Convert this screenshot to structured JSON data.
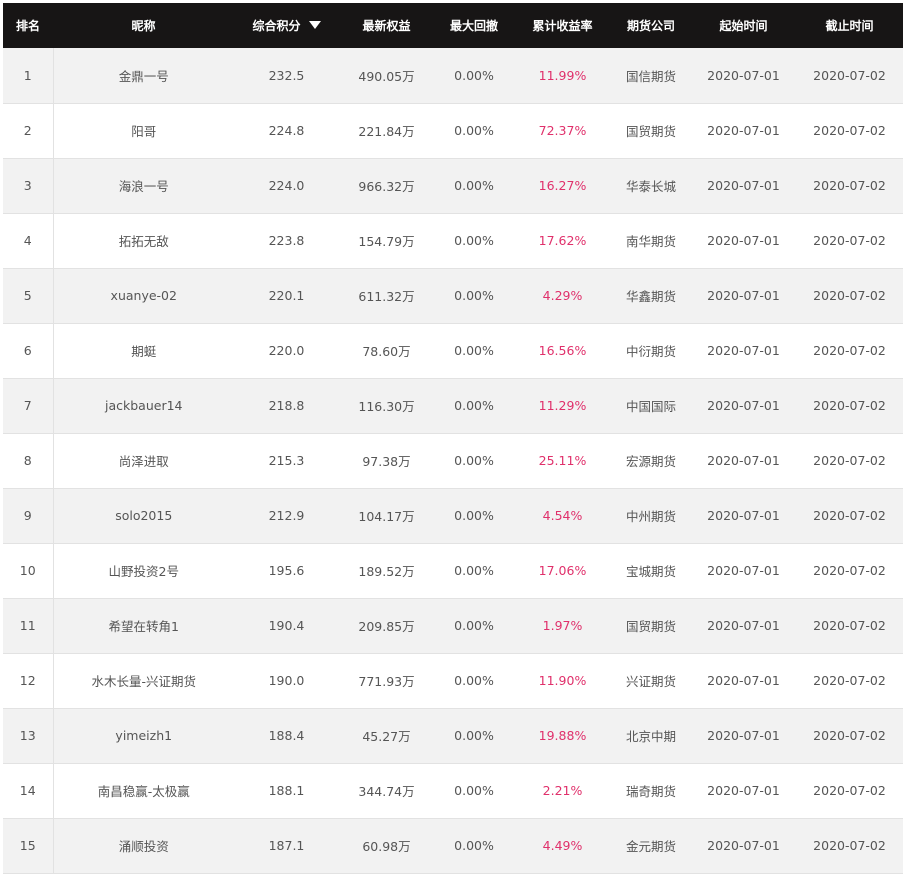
{
  "header": {
    "rank": "排名",
    "nickname": "昵称",
    "score": "综合积分",
    "equity": "最新权益",
    "drawdown": "最大回撤",
    "return": "累计收益率",
    "company": "期货公司",
    "start": "起始时间",
    "end": "截止时间",
    "sort_icon": "caret-down-icon"
  },
  "colors": {
    "header_bg": "#171515",
    "return_text": "#e0306b",
    "odd_row": "#f2f2f2"
  },
  "rows": [
    {
      "rank": "1",
      "nickname": "金鼎一号",
      "score": "232.5",
      "equity": "490.05万",
      "drawdown": "0.00%",
      "return": "11.99%",
      "company": "国信期货",
      "start": "2020-07-01",
      "end": "2020-07-02"
    },
    {
      "rank": "2",
      "nickname": "阳哥",
      "score": "224.8",
      "equity": "221.84万",
      "drawdown": "0.00%",
      "return": "72.37%",
      "company": "国贸期货",
      "start": "2020-07-01",
      "end": "2020-07-02"
    },
    {
      "rank": "3",
      "nickname": "海浪一号",
      "score": "224.0",
      "equity": "966.32万",
      "drawdown": "0.00%",
      "return": "16.27%",
      "company": "华泰长城",
      "start": "2020-07-01",
      "end": "2020-07-02"
    },
    {
      "rank": "4",
      "nickname": "拓拓无敌",
      "score": "223.8",
      "equity": "154.79万",
      "drawdown": "0.00%",
      "return": "17.62%",
      "company": "南华期货",
      "start": "2020-07-01",
      "end": "2020-07-02"
    },
    {
      "rank": "5",
      "nickname": "xuanye-02",
      "score": "220.1",
      "equity": "611.32万",
      "drawdown": "0.00%",
      "return": "4.29%",
      "company": "华鑫期货",
      "start": "2020-07-01",
      "end": "2020-07-02"
    },
    {
      "rank": "6",
      "nickname": "期蜓",
      "score": "220.0",
      "equity": "78.60万",
      "drawdown": "0.00%",
      "return": "16.56%",
      "company": "中衍期货",
      "start": "2020-07-01",
      "end": "2020-07-02"
    },
    {
      "rank": "7",
      "nickname": "jackbauer14",
      "score": "218.8",
      "equity": "116.30万",
      "drawdown": "0.00%",
      "return": "11.29%",
      "company": "中国国际",
      "start": "2020-07-01",
      "end": "2020-07-02"
    },
    {
      "rank": "8",
      "nickname": "尚泽进取",
      "score": "215.3",
      "equity": "97.38万",
      "drawdown": "0.00%",
      "return": "25.11%",
      "company": "宏源期货",
      "start": "2020-07-01",
      "end": "2020-07-02"
    },
    {
      "rank": "9",
      "nickname": "solo2015",
      "score": "212.9",
      "equity": "104.17万",
      "drawdown": "0.00%",
      "return": "4.54%",
      "company": "中州期货",
      "start": "2020-07-01",
      "end": "2020-07-02"
    },
    {
      "rank": "10",
      "nickname": "山野投资2号",
      "score": "195.6",
      "equity": "189.52万",
      "drawdown": "0.00%",
      "return": "17.06%",
      "company": "宝城期货",
      "start": "2020-07-01",
      "end": "2020-07-02"
    },
    {
      "rank": "11",
      "nickname": "希望在转角1",
      "score": "190.4",
      "equity": "209.85万",
      "drawdown": "0.00%",
      "return": "1.97%",
      "company": "国贸期货",
      "start": "2020-07-01",
      "end": "2020-07-02"
    },
    {
      "rank": "12",
      "nickname": "水木长量-兴证期货",
      "score": "190.0",
      "equity": "771.93万",
      "drawdown": "0.00%",
      "return": "11.90%",
      "company": "兴证期货",
      "start": "2020-07-01",
      "end": "2020-07-02"
    },
    {
      "rank": "13",
      "nickname": "yimeizh1",
      "score": "188.4",
      "equity": "45.27万",
      "drawdown": "0.00%",
      "return": "19.88%",
      "company": "北京中期",
      "start": "2020-07-01",
      "end": "2020-07-02"
    },
    {
      "rank": "14",
      "nickname": "南昌稳赢-太极赢",
      "score": "188.1",
      "equity": "344.74万",
      "drawdown": "0.00%",
      "return": "2.21%",
      "company": "瑞奇期货",
      "start": "2020-07-01",
      "end": "2020-07-02"
    },
    {
      "rank": "15",
      "nickname": "涌顺投资",
      "score": "187.1",
      "equity": "60.98万",
      "drawdown": "0.00%",
      "return": "4.49%",
      "company": "金元期货",
      "start": "2020-07-01",
      "end": "2020-07-02"
    }
  ]
}
